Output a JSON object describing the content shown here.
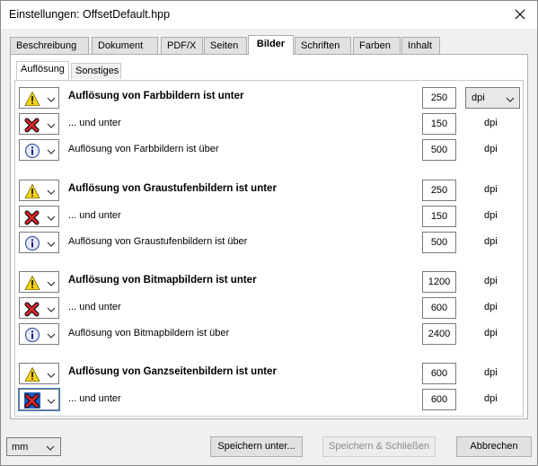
{
  "window": {
    "title": "Einstellungen:  OffsetDefault.hpp"
  },
  "tabs": [
    {
      "label": "Beschreibung"
    },
    {
      "label": "Dokument"
    },
    {
      "label": "PDF/X"
    },
    {
      "label": "Seiten"
    },
    {
      "label": "Bilder"
    },
    {
      "label": "Schriften"
    },
    {
      "label": "Farben"
    },
    {
      "label": "Inhalt"
    }
  ],
  "active_tab": "Bilder",
  "subtabs": [
    {
      "label": "Auflösung"
    },
    {
      "label": "Sonstiges"
    }
  ],
  "active_subtab": "Auflösung",
  "unit_select": {
    "value": "dpi"
  },
  "rows": [
    {
      "severity": "warning-icon",
      "label": "Auflösung von Farbbildern ist unter",
      "value": "250",
      "unit": "dpi"
    },
    {
      "severity": "error-icon",
      "label": "... und unter",
      "value": "150",
      "unit": "dpi"
    },
    {
      "severity": "info-icon",
      "label": "Auflösung von Farbbildern ist über",
      "value": "500",
      "unit": "dpi"
    },
    {
      "severity": "warning-icon",
      "label": "Auflösung von Graustufenbildern ist unter",
      "value": "250",
      "unit": "dpi"
    },
    {
      "severity": "error-icon",
      "label": "... und unter",
      "value": "150",
      "unit": "dpi"
    },
    {
      "severity": "info-icon",
      "label": "Auflösung von Graustufenbildern ist über",
      "value": "500",
      "unit": "dpi"
    },
    {
      "severity": "warning-icon",
      "label": "Auflösung von Bitmapbildern ist unter",
      "value": "1200",
      "unit": "dpi"
    },
    {
      "severity": "error-icon",
      "label": "... und unter",
      "value": "600",
      "unit": "dpi"
    },
    {
      "severity": "info-icon",
      "label": "Auflösung von Bitmapbildern ist über",
      "value": "2400",
      "unit": "dpi"
    },
    {
      "severity": "warning-icon",
      "label": "Auflösung von Ganzseitenbildern ist unter",
      "value": "600",
      "unit": "dpi"
    },
    {
      "severity": "error-icon",
      "label": "... und unter",
      "value": "600",
      "unit": "dpi"
    }
  ],
  "footer": {
    "measure_unit": "mm",
    "save_as_label": "Speichern unter...",
    "save_close_label": "Speichern & Schließen",
    "cancel_label": "Abbrechen"
  },
  "colors": {
    "warning": "#f7d31a",
    "error": "#d8282b",
    "info": "#3c5aa6"
  }
}
